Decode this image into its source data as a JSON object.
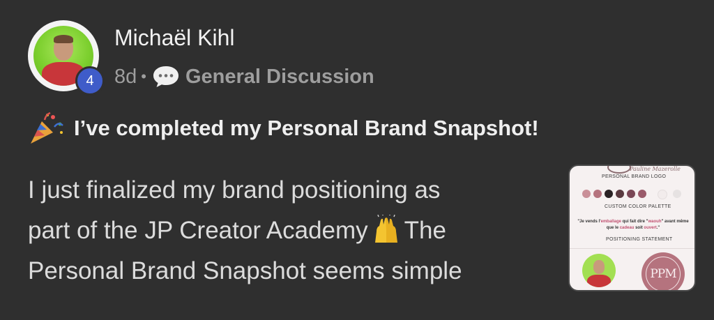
{
  "author": {
    "name": "Michaël Kihl",
    "level": "4",
    "avatar_icon": "user-avatar"
  },
  "meta": {
    "time": "8d",
    "separator": "•",
    "category_icon": "speech-bubble-icon",
    "category": "General Discussion"
  },
  "post": {
    "title_emoji": "party-popper-icon",
    "title": "I’ve completed my Personal Brand Snapshot!",
    "body_line1": "I just finalized my brand positioning as",
    "body_line2_a": "part of the JP Creator Academy",
    "body_line2_emoji": "raising-hands-icon",
    "body_line2_b": "The",
    "body_line3": "Personal Brand Snapshot seems simple"
  },
  "thumbnail": {
    "top_script": "Pauline Mazerolle",
    "logo_label": "PERSONAL BRAND LOGO",
    "palette_label": "CUSTOM COLOR PALETTE",
    "palette_colors": [
      "#c98f98",
      "#b5737e",
      "#2a2224",
      "#5a3a40",
      "#7a4756",
      "#9a5a6a",
      "#f2ecec",
      "#e6e2e2"
    ],
    "quote_part1": "\"Je vends l'",
    "quote_pink1": "emballage",
    "quote_part2": " qui fait dire \"",
    "quote_pink2": "waouh",
    "quote_part3": "\" avant même que le ",
    "quote_pink3": "cadeau",
    "quote_part4": " soit ",
    "quote_pink4": "ouvert",
    "quote_part5": ".\"",
    "positioning_label": "POSITIONING STATEMENT",
    "monogram": "PPM"
  },
  "colors": {
    "background": "#2f2f2f",
    "level_badge": "#3f5cc9",
    "meta_text": "#9e9e9e"
  }
}
